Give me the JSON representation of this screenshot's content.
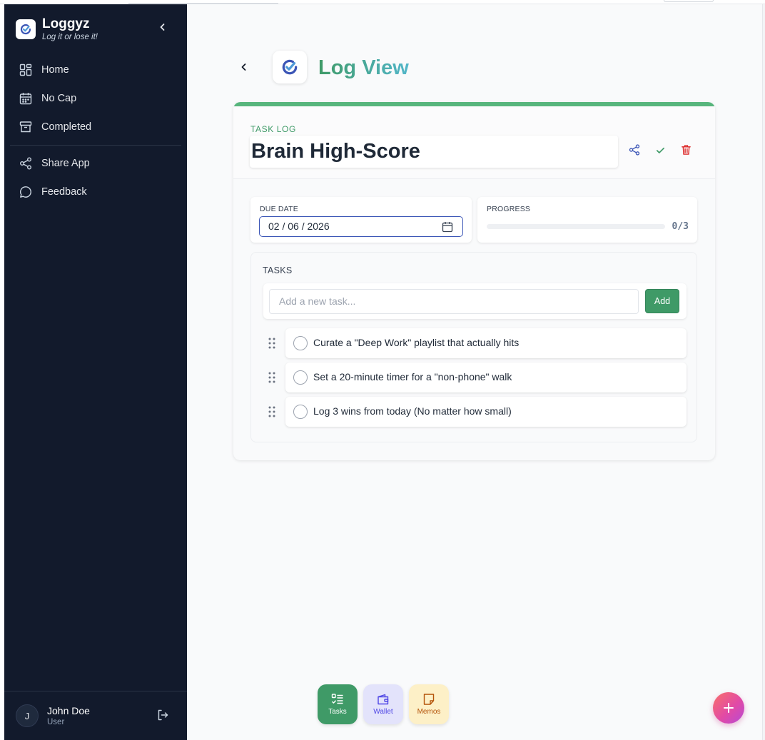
{
  "app": {
    "name": "Loggyz",
    "tagline": "Log it or lose it!"
  },
  "sidebar": {
    "items": [
      {
        "label": "Home",
        "icon": "grid-icon"
      },
      {
        "label": "No Cap",
        "icon": "calendar-icon"
      },
      {
        "label": "Completed",
        "icon": "archive-icon"
      },
      {
        "label": "Share App",
        "icon": "share-icon"
      },
      {
        "label": "Feedback",
        "icon": "chat-bubble-icon"
      }
    ]
  },
  "user": {
    "initial": "J",
    "name": "John Doe",
    "role": "User"
  },
  "page": {
    "title": "Log View"
  },
  "log": {
    "kicker": "TASK LOG",
    "title": "Brain High-Score",
    "due_label": "DUE DATE",
    "due_value": "02 / 06 / 2026",
    "progress_label": "PROGRESS",
    "progress_text": "0/3",
    "progress_fraction": 0,
    "tasks_label": "TASKS",
    "new_task_placeholder": "Add a new task...",
    "add_label": "Add",
    "tasks": [
      {
        "text": "Curate a \"Deep Work\" playlist that actually hits",
        "done": false
      },
      {
        "text": "Set a 20-minute timer for a \"non-phone\" walk",
        "done": false
      },
      {
        "text": "Log 3 wins from today (No matter how small)",
        "done": false
      }
    ]
  },
  "dock": [
    {
      "label": "Tasks",
      "icon": "checklist-icon",
      "bg": "#3f9a67",
      "fg": "#ffffff"
    },
    {
      "label": "Wallet",
      "icon": "wallet-icon",
      "bg": "#e3e3fb",
      "fg": "#4f46e5"
    },
    {
      "label": "Memos",
      "icon": "note-icon",
      "bg": "#fdf0c7",
      "fg": "#b45309"
    }
  ],
  "colors": {
    "accent_green": "#57b57c",
    "sidebar_bg": "#121a2c",
    "brand_blue": "#3b55b6",
    "danger": "#dc2626"
  }
}
